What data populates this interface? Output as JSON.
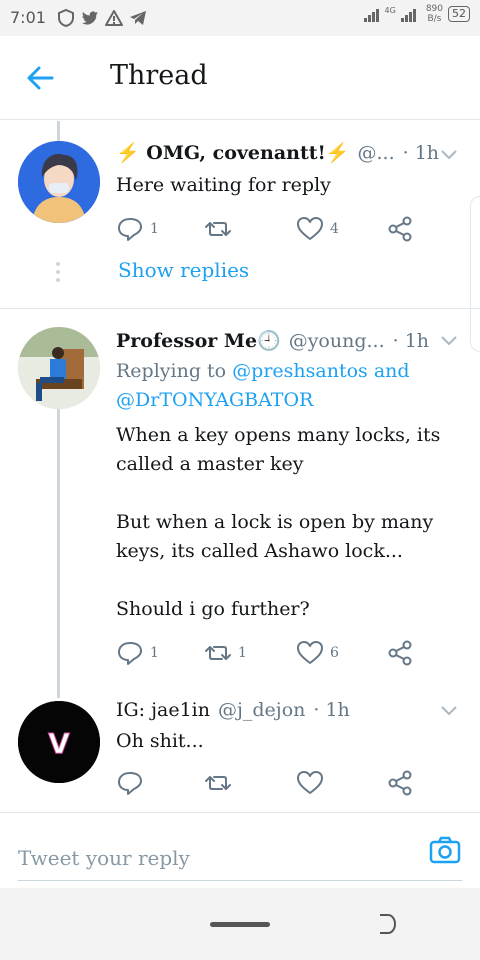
{
  "status_bar": {
    "time": "7:01",
    "network_label": "4G",
    "net_speed_value": "890",
    "net_speed_unit": "B/s",
    "battery": "52"
  },
  "header": {
    "title": "Thread",
    "back_icon": "arrow-left-icon"
  },
  "colors": {
    "accent": "#1da1f2",
    "text": "#14171a",
    "muted": "#657786",
    "divider": "#e1e8ed"
  },
  "tweets": [
    {
      "name": "⚡ OMG, covenantt!⚡",
      "handle": "@...",
      "time": "· 1h",
      "text": "Here waiting for reply",
      "replies": "1",
      "retweets": "",
      "likes": "4"
    },
    {
      "name": "Professor Me🕘",
      "handle": "@young...",
      "time": "· 1h",
      "replying_prefix": "Replying to ",
      "replying_mention_1": "@preshsantos",
      "replying_and": " and",
      "replying_mention_2": "@DrTONYAGBATOR",
      "text_lines": [
        "When a key opens many locks, its",
        "called a master key",
        "",
        "But when a lock is open by many",
        "keys, its called Ashawo lock...",
        "",
        "Should i go further?"
      ],
      "replies": "1",
      "retweets": "1",
      "likes": "6"
    },
    {
      "name": "IG: jae1in",
      "handle": "@j_dejon",
      "time": "· 1h",
      "text": "Oh shit...",
      "avatar_letter": "V",
      "replies": "",
      "retweets": "",
      "likes": ""
    }
  ],
  "show_replies": "Show replies",
  "reply_bar": {
    "placeholder": "Tweet your reply",
    "camera_icon": "camera-icon"
  }
}
